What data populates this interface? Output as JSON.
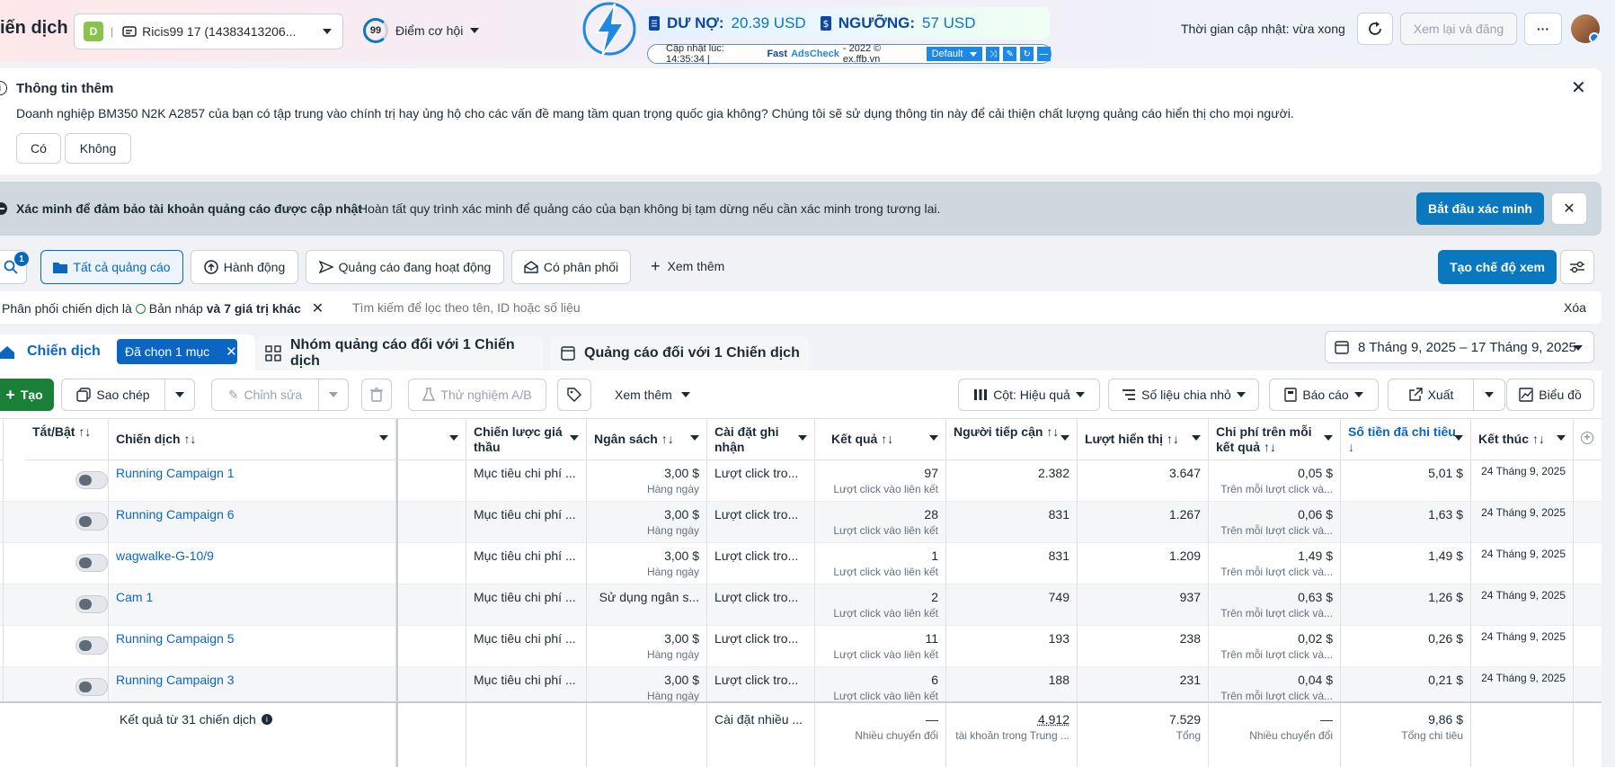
{
  "header": {
    "title_partial": "iến dịch",
    "account_badge": "D",
    "account_name": "Ricis99 17 (14383413206...",
    "score_value": "99",
    "score_label": "Điểm cơ hội",
    "update_time": "Thời gian cập nhật: vừa xong",
    "review_publish": "Xem lại và đăng",
    "more": "···"
  },
  "adscheck": {
    "debt_label": "DƯ NỢ:",
    "debt_value": "20.39 USD",
    "threshold_label": "NGƯỠNG:",
    "threshold_value": "57 USD",
    "updated": "Cập nhật lúc: 14:35:34 |",
    "brand_fast": "Fast",
    "brand_ads": "AdsCheck",
    "copyright": "- 2022 © ex.ffb.vn",
    "preset": "Default"
  },
  "info": {
    "title": "Thông tin thêm",
    "text": "Doanh nghiệp BM350 N2K A2857 của bạn có tập trung vào chính trị hay ủng hộ cho các vấn đề mang tầm quan trọng quốc gia không? Chúng tôi sẽ sử dụng thông tin này để cải thiện chất lượng quảng cáo hiển thị cho mọi người.",
    "yes": "Có",
    "no": "Không"
  },
  "verify": {
    "title": "Xác minh để đảm bảo tài khoản quảng cáo được cập nhật",
    "text": "Hoàn tất quy trình xác minh để quảng cáo của bạn không bị tạm dừng nếu cần xác minh trong tương lai.",
    "button": "Bắt đầu xác minh"
  },
  "filters": {
    "badge": "1",
    "all_ads": "Tất cả quảng cáo",
    "actions": "Hành động",
    "active_ads": "Quảng cáo đang hoạt động",
    "has_delivery": "Có phân phối",
    "see_more": "Xem thêm",
    "create_view": "Tạo chế độ xem"
  },
  "search": {
    "chip_prefix": "Phân phối chiến dịch là",
    "chip_value": "Bản nháp",
    "chip_suffix": "và 7 giá trị khác",
    "placeholder": "Tìm kiếm để lọc theo tên, ID hoặc số liệu",
    "clear": "Xóa"
  },
  "tabs": {
    "campaign": "Chiến dịch",
    "selected": "Đã chọn 1 mục",
    "adsets": "Nhóm quảng cáo đối với 1 Chiến dịch",
    "ads": "Quảng cáo đối với 1 Chiến dịch",
    "date_range": "8 Tháng 9, 2025 – 17 Tháng 9, 2025"
  },
  "toolbar": {
    "create": "Tạo",
    "copy": "Sao chép",
    "edit": "Chỉnh sửa",
    "ab_test": "Thử nghiệm A/B",
    "see_more": "Xem thêm",
    "columns": "Cột: Hiệu quả",
    "breakdown": "Số liệu chia nhỏ",
    "report": "Báo cáo",
    "export": "Xuất",
    "chart": "Biểu đồ"
  },
  "table": {
    "headers": {
      "toggle": "Tắt/Bật ↑↓",
      "campaign": "Chiến dịch ↑↓",
      "bid": "Chiến lược giá thầu",
      "budget": "Ngân sách ↑↓",
      "attribution": "Cài đặt ghi nhận",
      "results": "Kết quả ↑↓",
      "reach": "Người tiếp cận ↑↓",
      "impressions": "Lượt hiển thị ↑↓",
      "cpr": "Chi phí trên mỗi kết quả ↑↓",
      "spent": "Số tiền đã chi tiêu ↓",
      "end": "Kết thúc ↑↓"
    },
    "rows": [
      {
        "name": "Running Campaign 1",
        "bid": "Mục tiêu chi phí ...",
        "budget": "3,00 $",
        "budget_sub": "Hàng ngày",
        "attr": "Lượt click tro...",
        "results": "97",
        "results_sub": "Lượt click vào liên kết",
        "reach": "2.382",
        "impr": "3.647",
        "cpr": "0,05 $",
        "cpr_sub": "Trên mỗi lượt click và...",
        "spent": "5,01 $",
        "end": "24 Tháng 9, 2025"
      },
      {
        "name": "Running Campaign 6",
        "bid": "Mục tiêu chi phí ...",
        "budget": "3,00 $",
        "budget_sub": "Hàng ngày",
        "attr": "Lượt click tro...",
        "results": "28",
        "results_sub": "Lượt click vào liên kết",
        "reach": "831",
        "impr": "1.267",
        "cpr": "0,06 $",
        "cpr_sub": "Trên mỗi lượt click và...",
        "spent": "1,63 $",
        "end": "24 Tháng 9, 2025"
      },
      {
        "name": "wagwalke-G-10/9",
        "bid": "Mục tiêu chi phí ...",
        "budget": "3,00 $",
        "budget_sub": "Hàng ngày",
        "attr": "Lượt click tro...",
        "results": "1",
        "results_sub": "Lượt click vào liên kết",
        "reach": "831",
        "impr": "1.209",
        "cpr": "1,49 $",
        "cpr_sub": "Trên mỗi lượt click và...",
        "spent": "1,49 $",
        "end": "24 Tháng 9, 2025"
      },
      {
        "name": "Cam 1",
        "bid": "Mục tiêu chi phí ...",
        "budget": "Sử dụng ngân s...",
        "budget_sub": "",
        "attr": "Lượt click tro...",
        "results": "2",
        "results_sub": "Lượt click vào liên kết",
        "reach": "749",
        "impr": "937",
        "cpr": "0,63 $",
        "cpr_sub": "Trên mỗi lượt click và...",
        "spent": "1,26 $",
        "end": "24 Tháng 9, 2025"
      },
      {
        "name": "Running Campaign 5",
        "bid": "Mục tiêu chi phí ...",
        "budget": "3,00 $",
        "budget_sub": "Hàng ngày",
        "attr": "Lượt click tro...",
        "results": "11",
        "results_sub": "Lượt click vào liên kết",
        "reach": "193",
        "impr": "238",
        "cpr": "0,02 $",
        "cpr_sub": "Trên mỗi lượt click và...",
        "spent": "0,26 $",
        "end": "24 Tháng 9, 2025"
      },
      {
        "name": "Running Campaign 3",
        "bid": "Mục tiêu chi phí ...",
        "budget": "3,00 $",
        "budget_sub": "Hàng ngày",
        "attr": "Lượt click tro...",
        "results": "6",
        "results_sub": "Lượt click vào liên kết",
        "reach": "188",
        "impr": "231",
        "cpr": "0,04 $",
        "cpr_sub": "Trên mỗi lượt click và...",
        "spent": "0,21 $",
        "end": "24 Tháng 9, 2025"
      }
    ],
    "footer": {
      "label": "Kết quả từ 31 chiến dịch",
      "attr": "Cài đặt nhiều ...",
      "results": "—",
      "results_sub": "Nhiều chuyển đổi",
      "reach": "4.912",
      "reach_sub": "tài khoản trong Trung ...",
      "impr": "7.529",
      "impr_sub": "Tổng",
      "cpr": "—",
      "cpr_sub": "Nhiều chuyển đổi",
      "spent": "9,86 $",
      "spent_sub": "Tổng chi tiêu"
    }
  },
  "colors": {
    "primary": "#0a78be",
    "link": "#0a66c2",
    "badge_green": "#8bc34a",
    "create_green": "#1a7f37"
  }
}
